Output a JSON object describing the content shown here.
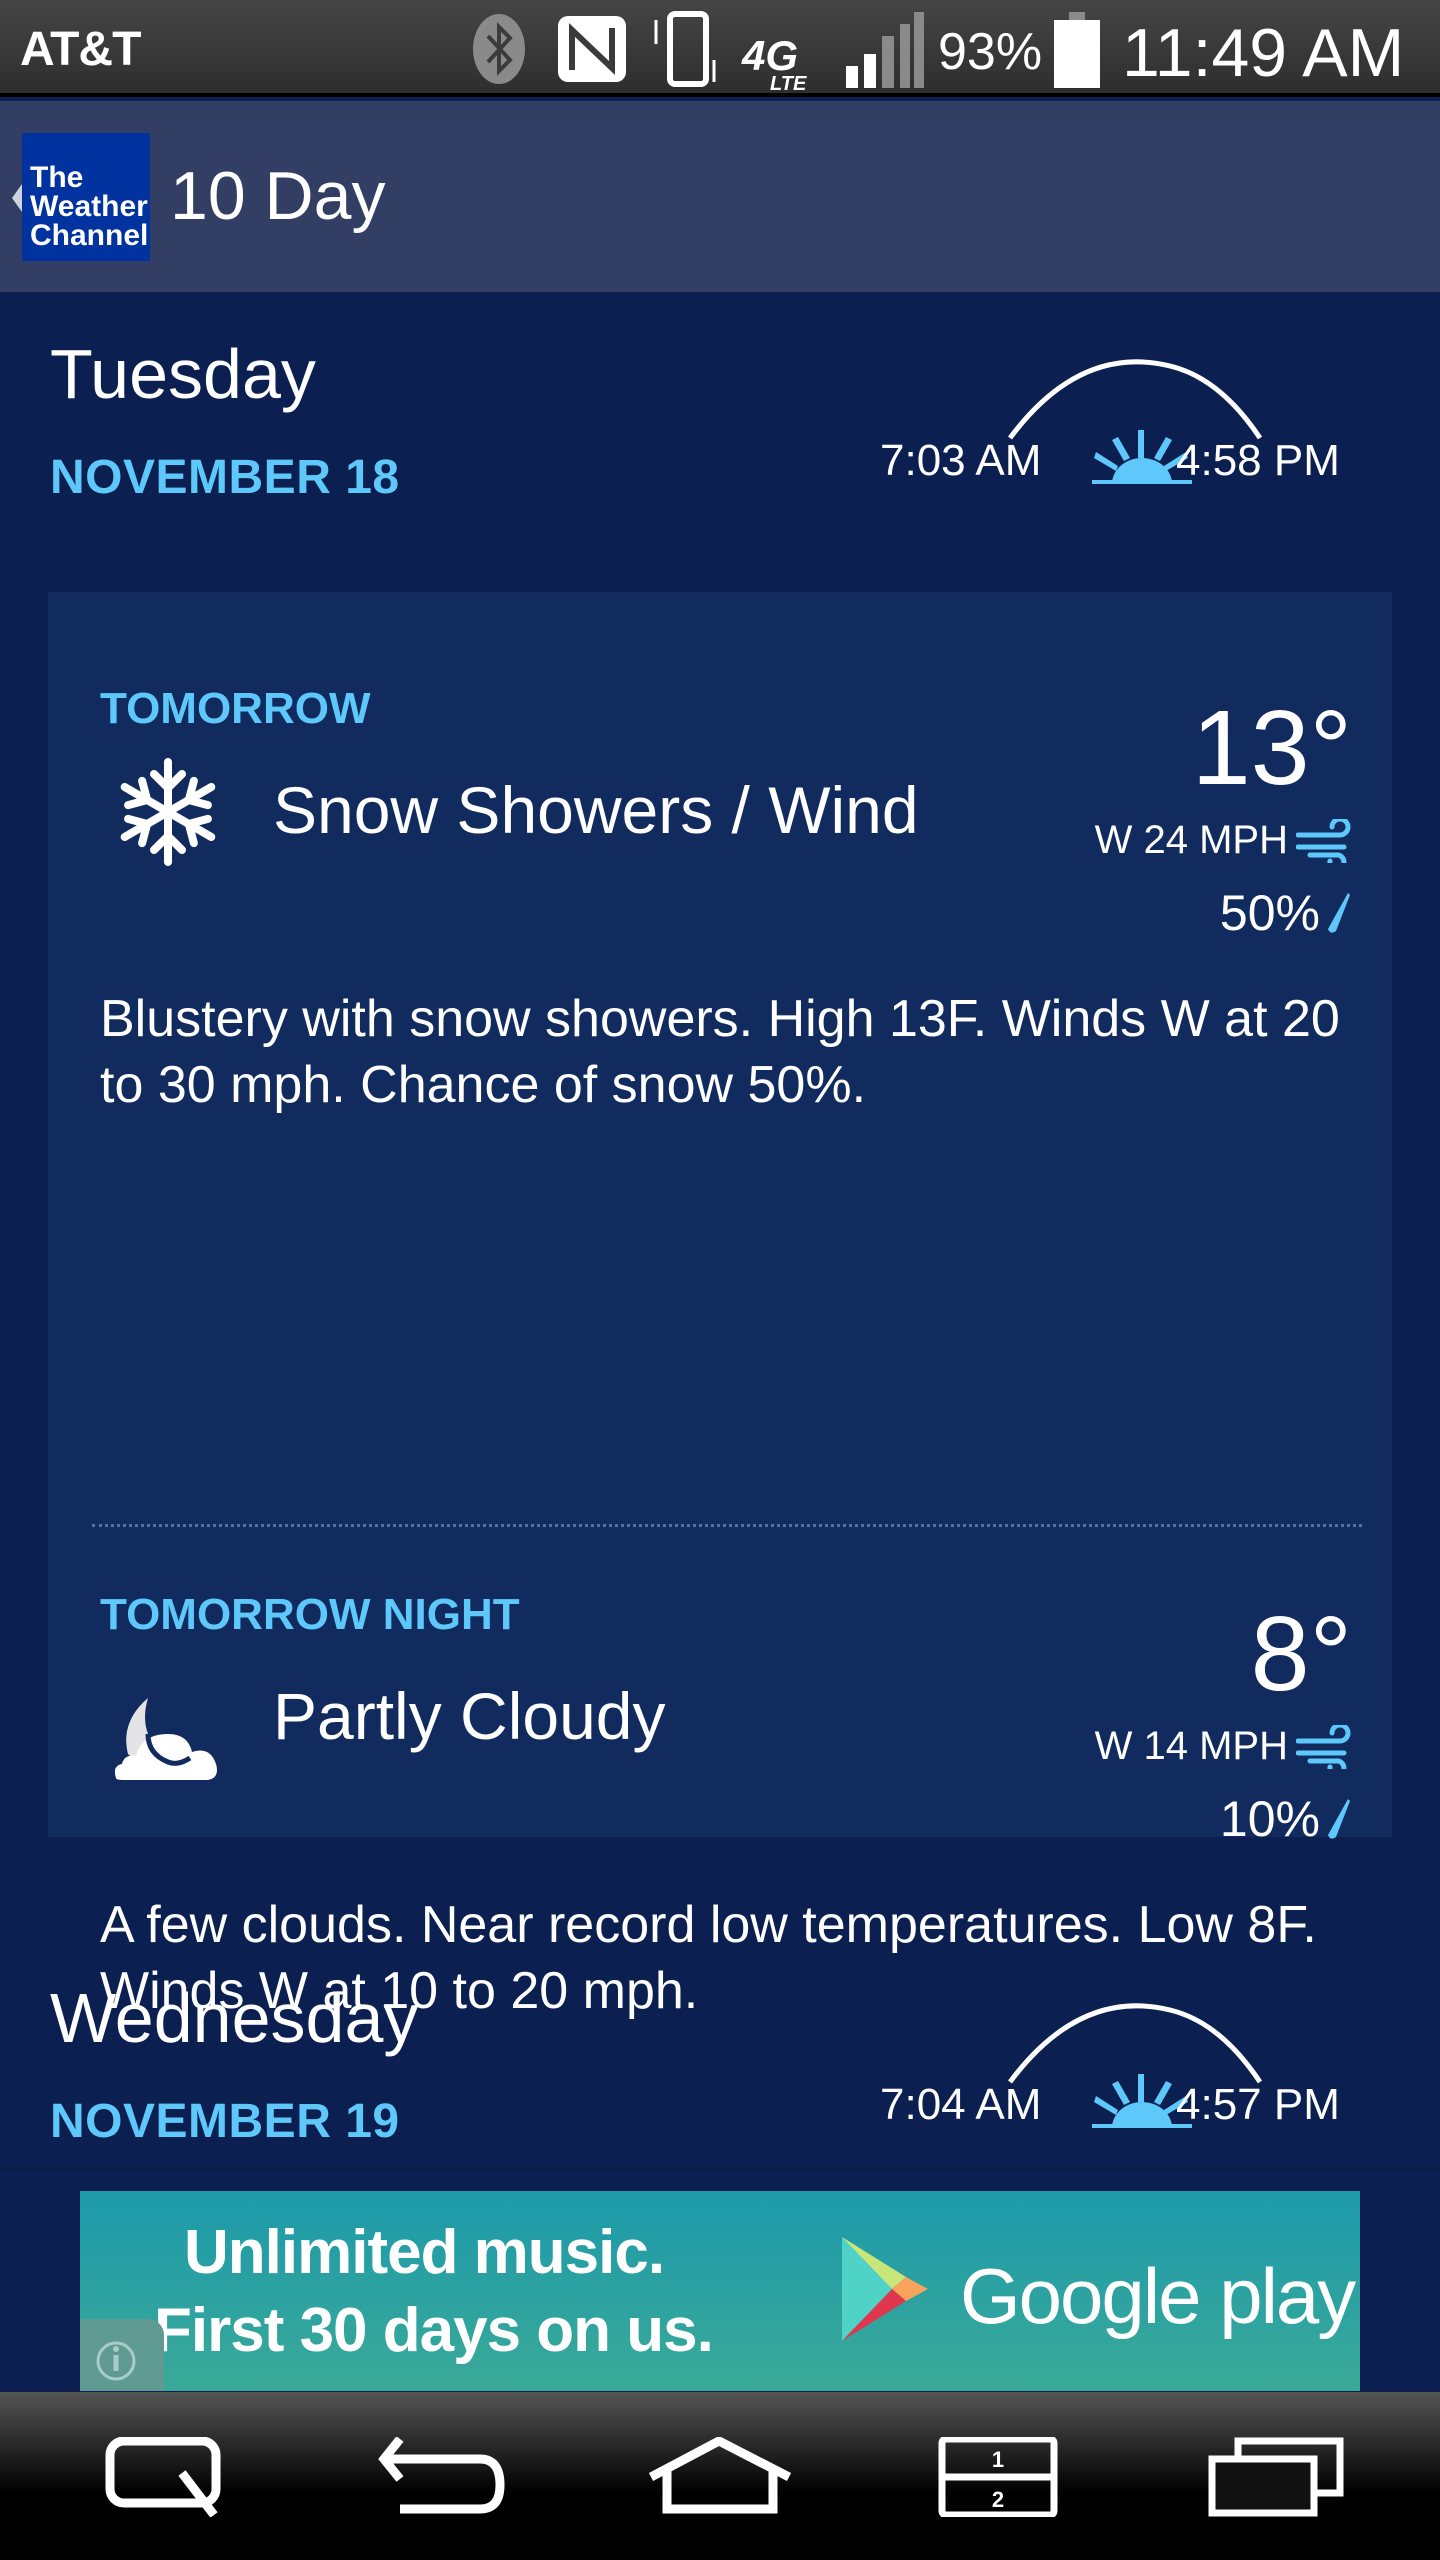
{
  "status_bar": {
    "carrier": "AT&T",
    "battery_percent": "93%",
    "time": "11:49 AM",
    "network": "4G LTE",
    "icons": [
      "bluetooth-icon",
      "nfc-icon",
      "vibrate-icon",
      "lte-icon",
      "signal-icon",
      "battery-icon"
    ]
  },
  "app_bar": {
    "logo_lines": [
      "The",
      "Weather",
      "Channel"
    ],
    "title": "10 Day"
  },
  "days": [
    {
      "day": "Tuesday",
      "date": "NOVEMBER 18",
      "sunrise": "7:03 AM",
      "sunset": "4:58 PM",
      "periods": [
        {
          "label": "TOMORROW",
          "icon": "snowflake-icon",
          "condition": "Snow Showers / Wind",
          "temp": "13°",
          "wind": "W 24 MPH",
          "precip": "50%",
          "narrative": "Blustery with snow showers. High 13F. Winds W at 20 to 30 mph. Chance of snow 50%."
        },
        {
          "label": "TOMORROW NIGHT",
          "icon": "moon-cloud-icon",
          "condition": "Partly Cloudy",
          "temp": "8°",
          "wind": "W 14 MPH",
          "precip": "10%",
          "narrative": "A few clouds. Near record low temperatures. Low 8F. Winds W at 10 to 20 mph."
        }
      ]
    },
    {
      "day": "Wednesday",
      "date": "NOVEMBER 19",
      "sunrise": "7:04 AM",
      "sunset": "4:57 PM"
    }
  ],
  "ad": {
    "line1": "Unlimited music.",
    "line2": "First 30 days on us.",
    "brand": "Google play"
  },
  "nav_bar": {
    "buttons": [
      "quick-memo",
      "back",
      "home",
      "dual-window",
      "recent-apps"
    ],
    "dual_window_labels": [
      "1",
      "2"
    ]
  },
  "colors": {
    "background": "#0b2050",
    "card": "#112b5e",
    "accent": "#5ec8fb",
    "app_bar": "#323e63"
  }
}
